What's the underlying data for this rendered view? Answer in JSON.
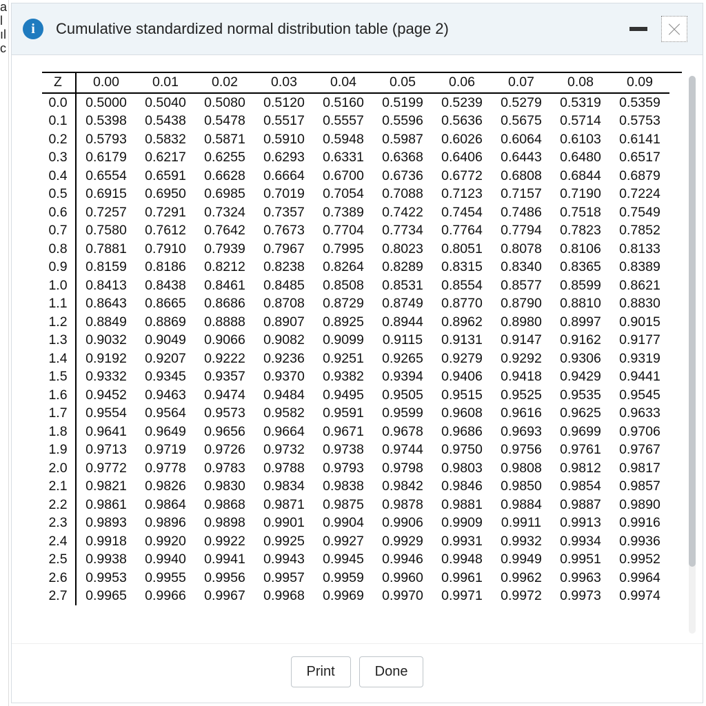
{
  "dialog": {
    "title": "Cumulative standardized normal distribution table (page 2)",
    "info_glyph": "i"
  },
  "footer": {
    "print_label": "Print",
    "done_label": "Done"
  },
  "left_strip": [
    "a",
    "l",
    "ıl",
    "",
    "",
    "",
    "",
    "",
    "",
    "",
    "",
    "",
    "",
    "",
    "",
    "",
    "",
    "c"
  ],
  "table": {
    "z_header": "Z",
    "col_headers": [
      "0.00",
      "0.01",
      "0.02",
      "0.03",
      "0.04",
      "0.05",
      "0.06",
      "0.07",
      "0.08",
      "0.09"
    ],
    "rows": [
      {
        "z": "0.0",
        "v": [
          "0.5000",
          "0.5040",
          "0.5080",
          "0.5120",
          "0.5160",
          "0.5199",
          "0.5239",
          "0.5279",
          "0.5319",
          "0.5359"
        ]
      },
      {
        "z": "0.1",
        "v": [
          "0.5398",
          "0.5438",
          "0.5478",
          "0.5517",
          "0.5557",
          "0.5596",
          "0.5636",
          "0.5675",
          "0.5714",
          "0.5753"
        ]
      },
      {
        "z": "0.2",
        "v": [
          "0.5793",
          "0.5832",
          "0.5871",
          "0.5910",
          "0.5948",
          "0.5987",
          "0.6026",
          "0.6064",
          "0.6103",
          "0.6141"
        ]
      },
      {
        "z": "0.3",
        "v": [
          "0.6179",
          "0.6217",
          "0.6255",
          "0.6293",
          "0.6331",
          "0.6368",
          "0.6406",
          "0.6443",
          "0.6480",
          "0.6517"
        ]
      },
      {
        "z": "0.4",
        "v": [
          "0.6554",
          "0.6591",
          "0.6628",
          "0.6664",
          "0.6700",
          "0.6736",
          "0.6772",
          "0.6808",
          "0.6844",
          "0.6879"
        ]
      },
      {
        "z": "0.5",
        "v": [
          "0.6915",
          "0.6950",
          "0.6985",
          "0.7019",
          "0.7054",
          "0.7088",
          "0.7123",
          "0.7157",
          "0.7190",
          "0.7224"
        ]
      },
      {
        "z": "0.6",
        "v": [
          "0.7257",
          "0.7291",
          "0.7324",
          "0.7357",
          "0.7389",
          "0.7422",
          "0.7454",
          "0.7486",
          "0.7518",
          "0.7549"
        ]
      },
      {
        "z": "0.7",
        "v": [
          "0.7580",
          "0.7612",
          "0.7642",
          "0.7673",
          "0.7704",
          "0.7734",
          "0.7764",
          "0.7794",
          "0.7823",
          "0.7852"
        ]
      },
      {
        "z": "0.8",
        "v": [
          "0.7881",
          "0.7910",
          "0.7939",
          "0.7967",
          "0.7995",
          "0.8023",
          "0.8051",
          "0.8078",
          "0.8106",
          "0.8133"
        ]
      },
      {
        "z": "0.9",
        "v": [
          "0.8159",
          "0.8186",
          "0.8212",
          "0.8238",
          "0.8264",
          "0.8289",
          "0.8315",
          "0.8340",
          "0.8365",
          "0.8389"
        ]
      },
      {
        "z": "1.0",
        "v": [
          "0.8413",
          "0.8438",
          "0.8461",
          "0.8485",
          "0.8508",
          "0.8531",
          "0.8554",
          "0.8577",
          "0.8599",
          "0.8621"
        ]
      },
      {
        "z": "1.1",
        "v": [
          "0.8643",
          "0.8665",
          "0.8686",
          "0.8708",
          "0.8729",
          "0.8749",
          "0.8770",
          "0.8790",
          "0.8810",
          "0.8830"
        ]
      },
      {
        "z": "1.2",
        "v": [
          "0.8849",
          "0.8869",
          "0.8888",
          "0.8907",
          "0.8925",
          "0.8944",
          "0.8962",
          "0.8980",
          "0.8997",
          "0.9015"
        ]
      },
      {
        "z": "1.3",
        "v": [
          "0.9032",
          "0.9049",
          "0.9066",
          "0.9082",
          "0.9099",
          "0.9115",
          "0.9131",
          "0.9147",
          "0.9162",
          "0.9177"
        ]
      },
      {
        "z": "1.4",
        "v": [
          "0.9192",
          "0.9207",
          "0.9222",
          "0.9236",
          "0.9251",
          "0.9265",
          "0.9279",
          "0.9292",
          "0.9306",
          "0.9319"
        ]
      },
      {
        "z": "1.5",
        "v": [
          "0.9332",
          "0.9345",
          "0.9357",
          "0.9370",
          "0.9382",
          "0.9394",
          "0.9406",
          "0.9418",
          "0.9429",
          "0.9441"
        ]
      },
      {
        "z": "1.6",
        "v": [
          "0.9452",
          "0.9463",
          "0.9474",
          "0.9484",
          "0.9495",
          "0.9505",
          "0.9515",
          "0.9525",
          "0.9535",
          "0.9545"
        ]
      },
      {
        "z": "1.7",
        "v": [
          "0.9554",
          "0.9564",
          "0.9573",
          "0.9582",
          "0.9591",
          "0.9599",
          "0.9608",
          "0.9616",
          "0.9625",
          "0.9633"
        ]
      },
      {
        "z": "1.8",
        "v": [
          "0.9641",
          "0.9649",
          "0.9656",
          "0.9664",
          "0.9671",
          "0.9678",
          "0.9686",
          "0.9693",
          "0.9699",
          "0.9706"
        ]
      },
      {
        "z": "1.9",
        "v": [
          "0.9713",
          "0.9719",
          "0.9726",
          "0.9732",
          "0.9738",
          "0.9744",
          "0.9750",
          "0.9756",
          "0.9761",
          "0.9767"
        ]
      },
      {
        "z": "2.0",
        "v": [
          "0.9772",
          "0.9778",
          "0.9783",
          "0.9788",
          "0.9793",
          "0.9798",
          "0.9803",
          "0.9808",
          "0.9812",
          "0.9817"
        ]
      },
      {
        "z": "2.1",
        "v": [
          "0.9821",
          "0.9826",
          "0.9830",
          "0.9834",
          "0.9838",
          "0.9842",
          "0.9846",
          "0.9850",
          "0.9854",
          "0.9857"
        ]
      },
      {
        "z": "2.2",
        "v": [
          "0.9861",
          "0.9864",
          "0.9868",
          "0.9871",
          "0.9875",
          "0.9878",
          "0.9881",
          "0.9884",
          "0.9887",
          "0.9890"
        ]
      },
      {
        "z": "2.3",
        "v": [
          "0.9893",
          "0.9896",
          "0.9898",
          "0.9901",
          "0.9904",
          "0.9906",
          "0.9909",
          "0.9911",
          "0.9913",
          "0.9916"
        ]
      },
      {
        "z": "2.4",
        "v": [
          "0.9918",
          "0.9920",
          "0.9922",
          "0.9925",
          "0.9927",
          "0.9929",
          "0.9931",
          "0.9932",
          "0.9934",
          "0.9936"
        ]
      },
      {
        "z": "2.5",
        "v": [
          "0.9938",
          "0.9940",
          "0.9941",
          "0.9943",
          "0.9945",
          "0.9946",
          "0.9948",
          "0.9949",
          "0.9951",
          "0.9952"
        ]
      },
      {
        "z": "2.6",
        "v": [
          "0.9953",
          "0.9955",
          "0.9956",
          "0.9957",
          "0.9959",
          "0.9960",
          "0.9961",
          "0.9962",
          "0.9963",
          "0.9964"
        ]
      },
      {
        "z": "2.7",
        "v": [
          "0.9965",
          "0.9966",
          "0.9967",
          "0.9968",
          "0.9969",
          "0.9970",
          "0.9971",
          "0.9972",
          "0.9973",
          "0.9974"
        ]
      }
    ]
  }
}
